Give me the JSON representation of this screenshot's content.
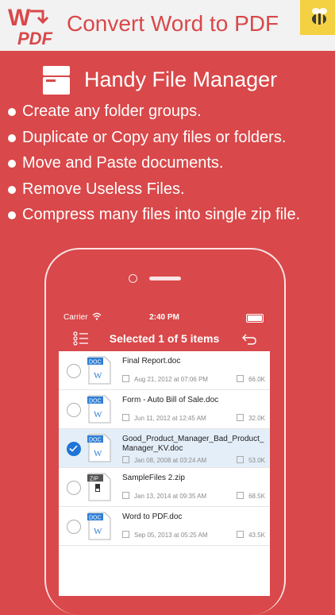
{
  "banner": {
    "logo_word": "W",
    "logo_pdf": "PDF",
    "title": "Convert Word to PDF"
  },
  "feature": {
    "title": "Handy File Manager",
    "bullets": [
      "Create any folder groups.",
      "Duplicate or Copy any files or folders.",
      "Move and Paste documents.",
      "Remove Useless Files.",
      "Compress many files into single zip file."
    ]
  },
  "app": {
    "status": {
      "carrier": "Carrier",
      "time": "2:40 PM"
    },
    "nav_title": "Selected 1 of 5 items",
    "files": [
      {
        "name": "Final Report.doc",
        "type": "DOC",
        "date": "Aug 21, 2012 at 07:06 PM",
        "size": "66.0K",
        "selected": false
      },
      {
        "name": "Form - Auto Bill of Sale.doc",
        "type": "DOC",
        "date": "Jun 11, 2012 at 12:45 AM",
        "size": "32.0K",
        "selected": false
      },
      {
        "name": "Good_Product_Manager_Bad_Product_Manager_KV.doc",
        "type": "DOC",
        "date": "Jan 08, 2008 at 03:24 AM",
        "size": "53.0K",
        "selected": true
      },
      {
        "name": "SampleFiles 2.zip",
        "type": "ZIP",
        "date": "Jan 13, 2014 at 09:35 AM",
        "size": "68.5K",
        "selected": false
      },
      {
        "name": "Word to PDF.doc",
        "type": "DOC",
        "date": "Sep 05, 2013 at 05:25 AM",
        "size": "43.5K",
        "selected": false
      }
    ]
  },
  "colors": {
    "brand_red": "#d9484a",
    "select_blue": "#1e74d8",
    "doc_blue": "#2f7fd6"
  }
}
